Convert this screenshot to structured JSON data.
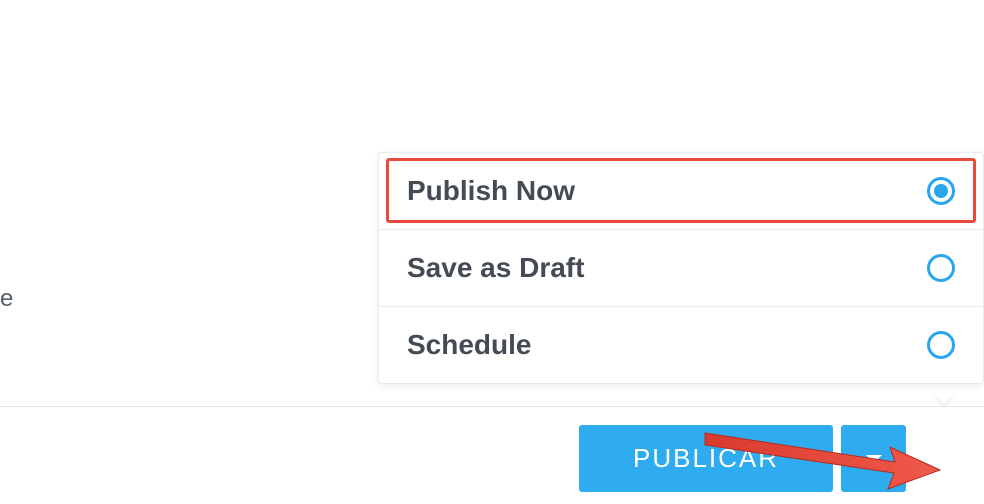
{
  "left_fragment": "e",
  "options": {
    "publish_now": "Publish Now",
    "save_draft": "Save as Draft",
    "schedule": "Schedule"
  },
  "button": {
    "publish_label": "PUBLICAR"
  }
}
